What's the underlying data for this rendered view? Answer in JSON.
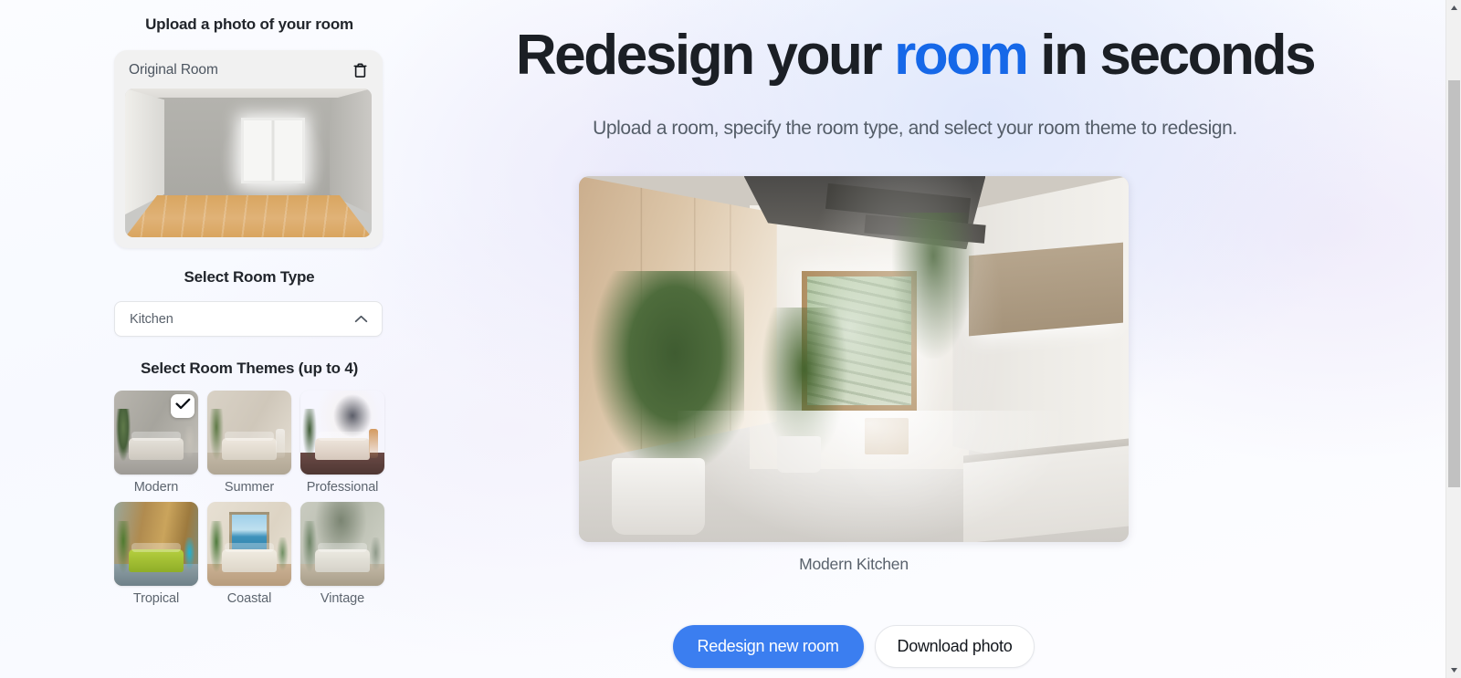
{
  "app": {
    "headline_part1": "Redesign your ",
    "headline_accent": "room",
    "headline_part2": " in seconds",
    "subheadline": "Upload a room, specify the room type, and select your room theme to redesign.",
    "accent_color": "#1668e8",
    "primary_button_color": "#3b7ef0"
  },
  "sidebar": {
    "upload_title": "Upload a photo of your room",
    "upload_card": {
      "label": "Original Room",
      "delete_icon": "trash-icon"
    },
    "room_type": {
      "title": "Select Room Type",
      "selected": "Kitchen",
      "chevron_icon": "chevron-up-icon",
      "expanded": true
    },
    "themes": {
      "title": "Select Room Themes (up to 4)",
      "max_selectable": 4,
      "items": [
        {
          "label": "Modern",
          "selected": true
        },
        {
          "label": "Summer",
          "selected": false
        },
        {
          "label": "Professional",
          "selected": false
        },
        {
          "label": "Tropical",
          "selected": false
        },
        {
          "label": "Coastal",
          "selected": false
        },
        {
          "label": "Vintage",
          "selected": false
        }
      ],
      "check_icon": "check-icon"
    }
  },
  "result": {
    "caption": "Modern Kitchen",
    "image_alt": "modern-kitchen-render"
  },
  "actions": {
    "primary_label": "Redesign new room",
    "secondary_label": "Download photo"
  },
  "scrollbar": {
    "up_icon": "triangle-up-icon",
    "down_icon": "triangle-down-icon",
    "orientation": "vertical"
  }
}
